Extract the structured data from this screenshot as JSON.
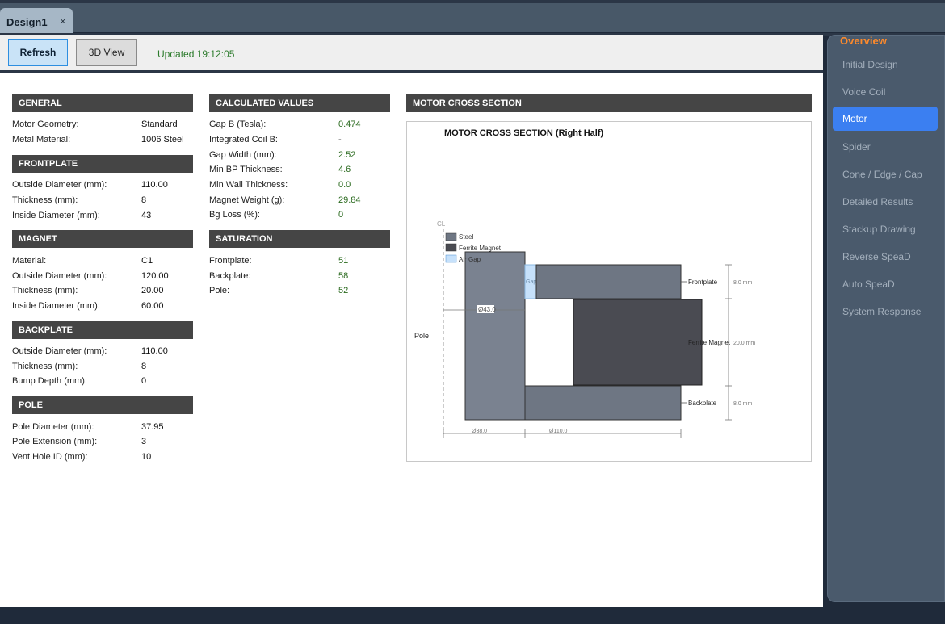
{
  "tab": {
    "title": "Design1",
    "close_glyph": "×"
  },
  "toolbar": {
    "refresh_label": "Refresh",
    "view3d_label": "3D View",
    "updated_text": "Updated 19:12:05"
  },
  "general": {
    "title": "GENERAL",
    "rows": [
      {
        "label": "Motor Geometry:",
        "value": "Standard"
      },
      {
        "label": "Metal Material:",
        "value": "1006 Steel"
      }
    ]
  },
  "frontplate": {
    "title": "FRONTPLATE",
    "rows": [
      {
        "label": "Outside Diameter (mm):",
        "value": "110.00"
      },
      {
        "label": "Thickness (mm):",
        "value": "8"
      },
      {
        "label": "Inside Diameter (mm):",
        "value": "43"
      }
    ]
  },
  "magnet": {
    "title": "MAGNET",
    "rows": [
      {
        "label": "Material:",
        "value": "C1"
      },
      {
        "label": "Outside Diameter (mm):",
        "value": "120.00"
      },
      {
        "label": "Thickness (mm):",
        "value": "20.00"
      },
      {
        "label": "Inside Diameter (mm):",
        "value": "60.00"
      }
    ]
  },
  "backplate": {
    "title": "BACKPLATE",
    "rows": [
      {
        "label": "Outside Diameter (mm):",
        "value": "110.00"
      },
      {
        "label": "Thickness (mm):",
        "value": "8"
      },
      {
        "label": "Bump Depth (mm):",
        "value": "0"
      }
    ]
  },
  "pole": {
    "title": "POLE",
    "rows": [
      {
        "label": "Pole Diameter (mm):",
        "value": "37.95"
      },
      {
        "label": "Pole Extension (mm):",
        "value": "3"
      },
      {
        "label": "Vent Hole ID (mm):",
        "value": "10"
      }
    ]
  },
  "calculated": {
    "title": "CALCULATED VALUES",
    "rows": [
      {
        "label": "Gap B (Tesla):",
        "value": "0.474"
      },
      {
        "label": "Integrated Coil B:",
        "value": "-"
      },
      {
        "label": "Gap Width (mm):",
        "value": "2.52"
      },
      {
        "label": "Min BP Thickness:",
        "value": "4.6"
      },
      {
        "label": "Min Wall Thickness:",
        "value": "0.0"
      },
      {
        "label": "Magnet Weight (g):",
        "value": "29.84"
      },
      {
        "label": "Bg Loss (%):",
        "value": "0"
      }
    ]
  },
  "saturation": {
    "title": "SATURATION",
    "rows": [
      {
        "label": "Frontplate:",
        "value": "51"
      },
      {
        "label": "Backplate:",
        "value": "58"
      },
      {
        "label": "Pole:",
        "value": "52"
      }
    ]
  },
  "cross_section": {
    "header": "MOTOR CROSS SECTION",
    "title": "MOTOR CROSS SECTION  (Right Half)",
    "cl_label": "CL",
    "pole_label": "Pole",
    "gap_label": "Gap",
    "legend": [
      {
        "label": "Steel",
        "color": "#6e7683"
      },
      {
        "label": "Ferrite Magnet",
        "color": "#4a4b52"
      },
      {
        "label": "Air Gap",
        "color": "#c6e1fb"
      }
    ],
    "part_labels": {
      "frontplate": "Frontplate",
      "magnet": "Ferrite Magnet",
      "backplate": "Backplate"
    },
    "dims": {
      "fp_thickness": "8.0 mm",
      "mag_thickness": "20.0 mm",
      "bp_thickness": "8.0 mm",
      "fp_id": "Ø43.0",
      "pole_dia": "Ø38.0",
      "od": "Ø110.0"
    },
    "colors": {
      "steel": "#6e7683",
      "pole": "#7a8290",
      "magnet": "#4a4b52",
      "gap": "#c6e1fb"
    }
  },
  "sidebar": {
    "title": "Overview",
    "items": [
      {
        "label": "Initial Design",
        "active": false
      },
      {
        "label": "Voice Coil",
        "active": false
      },
      {
        "label": "Motor",
        "active": true
      },
      {
        "label": "Spider",
        "active": false
      },
      {
        "label": "Cone / Edge / Cap",
        "active": false
      },
      {
        "label": "Detailed Results",
        "active": false
      },
      {
        "label": "Stackup Drawing",
        "active": false
      },
      {
        "label": "Reverse SpeaD",
        "active": false
      },
      {
        "label": "Auto SpeaD",
        "active": false
      },
      {
        "label": "System Response",
        "active": false
      }
    ]
  }
}
